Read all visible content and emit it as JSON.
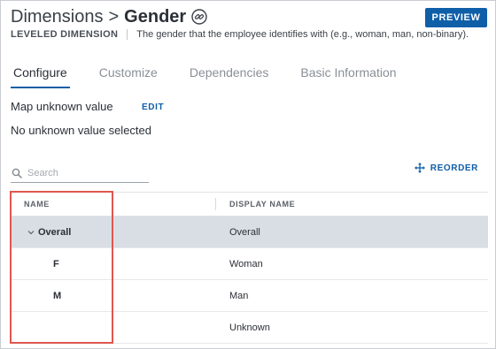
{
  "header": {
    "parent": "Dimensions",
    "separator": ">",
    "title": "Gender",
    "preview_label": "PREVIEW"
  },
  "subheader": {
    "kind": "LEVELED DIMENSION",
    "description": "The gender that the employee identifies with (e.g., woman, man, non-binary)."
  },
  "tabs": [
    {
      "label": "Configure",
      "active": true
    },
    {
      "label": "Customize",
      "active": false
    },
    {
      "label": "Dependencies",
      "active": false
    },
    {
      "label": "Basic Information",
      "active": false
    }
  ],
  "config": {
    "map_unknown_label": "Map unknown value",
    "edit_label": "EDIT",
    "unknown_status": "No unknown value selected"
  },
  "search": {
    "placeholder": "Search",
    "value": ""
  },
  "reorder_label": "REORDER",
  "table": {
    "columns": [
      "NAME",
      "DISPLAY NAME"
    ],
    "rows": [
      {
        "name": "Overall",
        "display": "Overall",
        "expanded": true
      },
      {
        "name": "F",
        "display": "Woman"
      },
      {
        "name": "M",
        "display": "Man"
      },
      {
        "name": "",
        "display": "Unknown"
      }
    ]
  },
  "colors": {
    "accent": "#0f5ea8",
    "selected_row": "#d9dee4",
    "highlight_box": "#e0564e"
  },
  "icons": {
    "title": "link-icon",
    "search": "search-icon",
    "reorder": "move-icon",
    "expand": "chevron-down-icon"
  }
}
